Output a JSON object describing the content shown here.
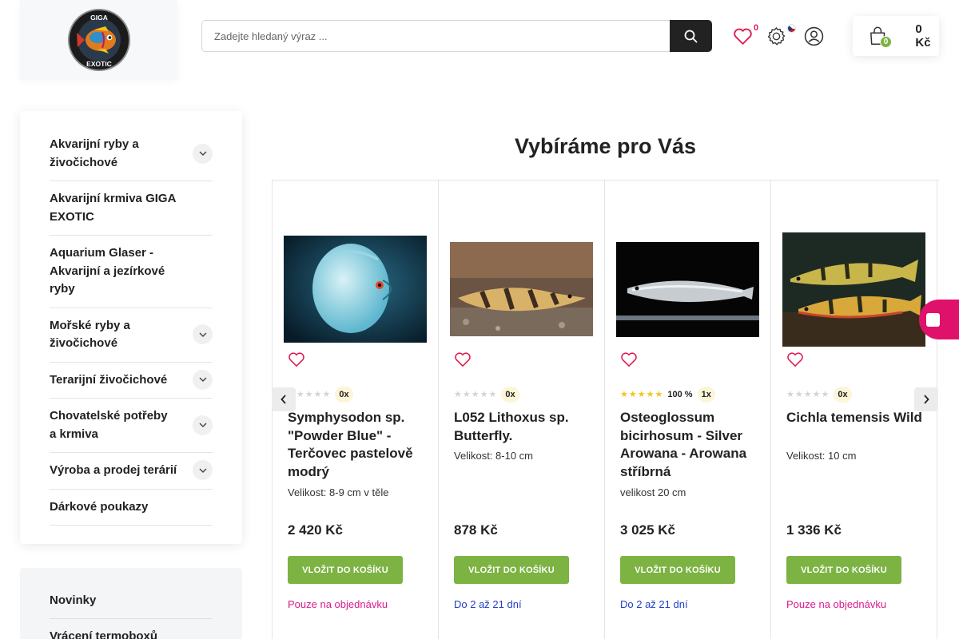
{
  "header": {
    "logo_text_top": "GIGA",
    "logo_text_bottom": "EXOTIC",
    "search_placeholder": "Zadejte hledaný výraz ...",
    "wishlist_count": "0",
    "cart_count": "0",
    "cart_total": "0 Kč",
    "icons": [
      "heart-icon",
      "settings-icon",
      "user-icon",
      "basket-icon",
      "search-icon"
    ]
  },
  "sidebar": {
    "categories": [
      {
        "label": "Akvarijní ryby a živočichové",
        "expandable": true
      },
      {
        "label": "Akvarijní krmiva GIGA EXOTIC",
        "expandable": false
      },
      {
        "label": "Aquarium Glaser - Akvarijní a jezírkové ryby",
        "expandable": false
      },
      {
        "label": "Mořské ryby a živočichové",
        "expandable": true
      },
      {
        "label": "Terarijní živočichové",
        "expandable": true
      },
      {
        "label": "Chovatelské potřeby a krmiva",
        "expandable": true
      },
      {
        "label": "Výroba a prodej terárií",
        "expandable": true
      },
      {
        "label": "Dárkové poukazy",
        "expandable": false
      }
    ],
    "links": [
      "Novinky",
      "Vrácení termoboxů"
    ]
  },
  "main": {
    "section_title": "Vybíráme pro Vás",
    "buy_label": "VLOŽIT DO KOŠÍKU",
    "products": [
      {
        "name": "Symphysodon sp. \"Powder Blue\" - Terčovec pastelově modrý",
        "size": "Velikost: 8-9 cm v těle",
        "price": "2 420 Kč",
        "rating_stars": 0,
        "rating_pct": "",
        "rating_count": "0x",
        "availability": "Pouze na objednávku",
        "availability_color": "#d81b8c"
      },
      {
        "name": "L052 Lithoxus sp. Butterfly.",
        "size": "Velikost: 8-10 cm",
        "price": "878 Kč",
        "rating_stars": 0,
        "rating_pct": "",
        "rating_count": "0x",
        "availability": "Do 2 až 21 dní",
        "availability_color": "#1f3fc8"
      },
      {
        "name": "Osteoglossum bicirhosum - Silver Arowana - Arowana stříbrná",
        "size": "velikost 20 cm",
        "price": "3 025 Kč",
        "rating_stars": 5,
        "rating_pct": "100 %",
        "rating_count": "1x",
        "availability": "Do 2 až 21 dní",
        "availability_color": "#1f3fc8"
      },
      {
        "name": "Cichla temensis Wild",
        "size": "Velikost: 10 cm",
        "price": "1 336 Kč",
        "rating_stars": 0,
        "rating_pct": "",
        "rating_count": "0x",
        "availability": "Pouze na objednávku",
        "availability_color": "#d81b8c"
      }
    ]
  },
  "colors": {
    "accent_green": "#7cb342",
    "wishlist_red": "#e0194f",
    "side_tab_pink": "#e0116b"
  }
}
